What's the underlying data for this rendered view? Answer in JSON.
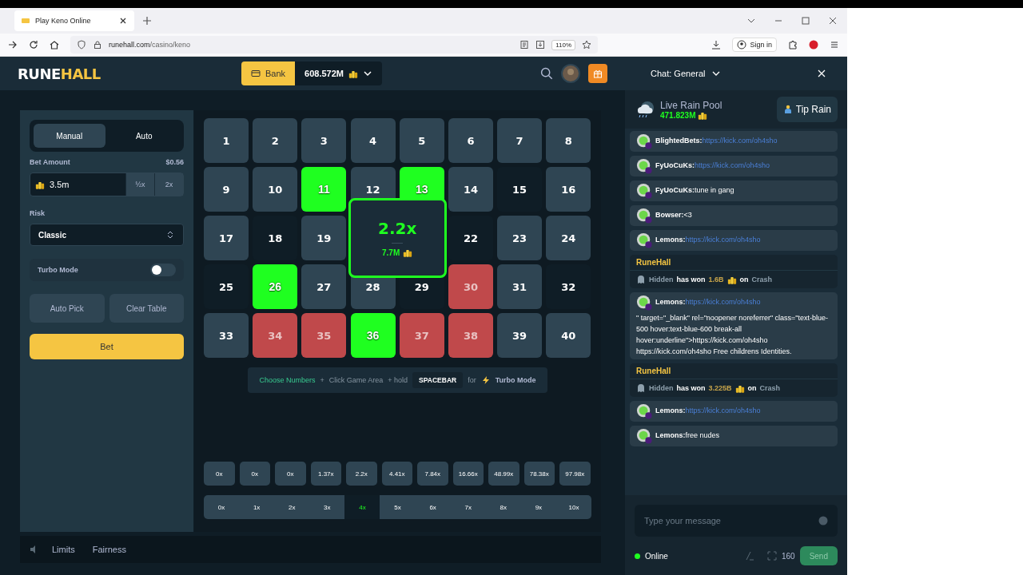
{
  "browser": {
    "tab_title": "Play Keno Online",
    "url_host": "runehall.com",
    "url_path": "/casino/keno",
    "zoom": "110%",
    "sign_in": "Sign in"
  },
  "header": {
    "logo_a": "RUNE",
    "logo_b": "HALL",
    "bank": "Bank",
    "balance": "608.572M"
  },
  "bet_panel": {
    "modes": [
      {
        "label": "Manual",
        "selected": true
      },
      {
        "label": "Auto",
        "selected": false
      }
    ],
    "bet_label": "Bet Amount",
    "bet_usd": "$0.56",
    "bet_value": "3.5m",
    "half": "½x",
    "double": "2x",
    "risk_label": "Risk",
    "risk_value": "Classic",
    "turbo_label": "Turbo Mode",
    "turbo_on": false,
    "auto_pick": "Auto Pick",
    "clear": "Clear Table",
    "bet": "Bet"
  },
  "tiles": [
    {
      "kind": "tile",
      "label": "1",
      "selected": false,
      "drawn": false
    },
    {
      "kind": "tile",
      "label": "2",
      "selected": false,
      "drawn": false
    },
    {
      "kind": "tile",
      "label": "3",
      "selected": false,
      "drawn": false
    },
    {
      "kind": "tile",
      "label": "4",
      "selected": false,
      "drawn": false
    },
    {
      "kind": "tile",
      "label": "5",
      "selected": false,
      "drawn": false
    },
    {
      "kind": "tile",
      "label": "6",
      "selected": false,
      "drawn": false
    },
    {
      "kind": "tile",
      "label": "7",
      "selected": false,
      "drawn": false
    },
    {
      "kind": "tile",
      "label": "8",
      "selected": false,
      "drawn": false
    },
    {
      "kind": "tile",
      "label": "9",
      "selected": false,
      "drawn": false
    },
    {
      "kind": "tile",
      "label": "10",
      "selected": false,
      "drawn": false
    },
    {
      "kind": "tile",
      "label": "11",
      "selected": true,
      "drawn": true
    },
    {
      "kind": "tile",
      "label": "12",
      "selected": false,
      "drawn": false
    },
    {
      "kind": "tile",
      "label": "13",
      "selected": true,
      "drawn": true
    },
    {
      "kind": "tile",
      "label": "14",
      "selected": false,
      "drawn": false
    },
    {
      "kind": "tile",
      "label": "15",
      "selected": false,
      "drawn": true
    },
    {
      "kind": "tile",
      "label": "16",
      "selected": false,
      "drawn": false
    },
    {
      "kind": "tile",
      "label": "17",
      "selected": false,
      "drawn": false
    },
    {
      "kind": "tile",
      "label": "18",
      "selected": false,
      "drawn": true
    },
    {
      "kind": "tile",
      "label": "19",
      "selected": false,
      "drawn": false
    },
    {
      "kind": "result",
      "multiplier": "2.2x",
      "payout": "7.7M"
    },
    {
      "kind": "tile",
      "label": "22",
      "selected": false,
      "drawn": true
    },
    {
      "kind": "tile",
      "label": "23",
      "selected": false,
      "drawn": false
    },
    {
      "kind": "tile",
      "label": "24",
      "selected": false,
      "drawn": false
    },
    {
      "kind": "tile",
      "label": "25",
      "selected": false,
      "drawn": true
    },
    {
      "kind": "tile",
      "label": "26",
      "selected": true,
      "drawn": true
    },
    {
      "kind": "tile",
      "label": "27",
      "selected": false,
      "drawn": false
    },
    {
      "kind": "tile",
      "label": "28",
      "selected": false,
      "drawn": false
    },
    {
      "kind": "tile",
      "label": "29",
      "selected": false,
      "drawn": true
    },
    {
      "kind": "tile",
      "label": "30",
      "selected": true,
      "drawn": false
    },
    {
      "kind": "tile",
      "label": "31",
      "selected": false,
      "drawn": false
    },
    {
      "kind": "tile",
      "label": "32",
      "selected": false,
      "drawn": true
    },
    {
      "kind": "tile",
      "label": "33",
      "selected": false,
      "drawn": false
    },
    {
      "kind": "tile",
      "label": "34",
      "selected": true,
      "drawn": false
    },
    {
      "kind": "tile",
      "label": "35",
      "selected": true,
      "drawn": false
    },
    {
      "kind": "tile",
      "label": "36",
      "selected": true,
      "drawn": true
    },
    {
      "kind": "tile",
      "label": "37",
      "selected": true,
      "drawn": false
    },
    {
      "kind": "tile",
      "label": "38",
      "selected": true,
      "drawn": false
    },
    {
      "kind": "tile",
      "label": "39",
      "selected": false,
      "drawn": false
    },
    {
      "kind": "tile",
      "label": "40",
      "selected": false,
      "drawn": false
    }
  ],
  "hint": {
    "choose": "Choose Numbers",
    "plus": "+",
    "click": "Click Game Area",
    "hold": "+ hold",
    "key": "SPACEBAR",
    "for": "for",
    "turbo": "Turbo Mode"
  },
  "payouts": [
    "0x",
    "0x",
    "0x",
    "1.37x",
    "2.2x",
    "4.41x",
    "7.84x",
    "16.66x",
    "48.99x",
    "78.38x",
    "97.98x"
  ],
  "hits": [
    {
      "label": "0x",
      "selected": false
    },
    {
      "label": "1x",
      "selected": false
    },
    {
      "label": "2x",
      "selected": false
    },
    {
      "label": "3x",
      "selected": false
    },
    {
      "label": "4x",
      "selected": true
    },
    {
      "label": "5x",
      "selected": false
    },
    {
      "label": "6x",
      "selected": false
    },
    {
      "label": "7x",
      "selected": false
    },
    {
      "label": "8x",
      "selected": false
    },
    {
      "label": "9x",
      "selected": false
    },
    {
      "label": "10x",
      "selected": false
    }
  ],
  "footer": {
    "limits": "Limits",
    "fairness": "Fairness"
  },
  "chat": {
    "title": "Chat: General",
    "rain_title": "Live Rain Pool",
    "rain_amount": "471.823M",
    "tip": "Tip Rain",
    "messages": [
      {
        "kind": "user",
        "user": "BlightedBets:",
        "link": "https://kick.com/oh4sho"
      },
      {
        "kind": "user",
        "user": "FyUoCuKs:",
        "link": "https://kick.com/oh4sho"
      },
      {
        "kind": "user",
        "user": "FyUoCuKs:",
        "text": "tune in gang"
      },
      {
        "kind": "user",
        "user": "Bowser:",
        "text": "<3"
      },
      {
        "kind": "user",
        "user": "Lemons:",
        "link": "https://kick.com/oh4sho"
      },
      {
        "kind": "system",
        "sender": "RuneHall",
        "player": "Hidden",
        "won": "has won",
        "amount": "1.6B",
        "on": "on",
        "game": "Crash"
      },
      {
        "kind": "user",
        "user": "Lemons:",
        "link": "https://kick.com/oh4sho",
        "text": "\" target=\"_blank\" rel=\"noopener noreferrer\" class=\"text-blue-500 hover:text-blue-600 break-all hover:underline\">https://kick.com/oh4sho https://kick.com/oh4sho Free childrens Identities."
      },
      {
        "kind": "system",
        "sender": "RuneHall",
        "player": "Hidden",
        "won": "has won",
        "amount": "3.225B",
        "on": "on",
        "game": "Crash"
      },
      {
        "kind": "user",
        "user": "Lemons:",
        "link": "https://kick.com/oh4sho"
      },
      {
        "kind": "user",
        "user": "Lemons:",
        "text": "free nudes"
      }
    ],
    "placeholder": "Type your message",
    "status": "Online",
    "count": "160",
    "send": "Send"
  }
}
